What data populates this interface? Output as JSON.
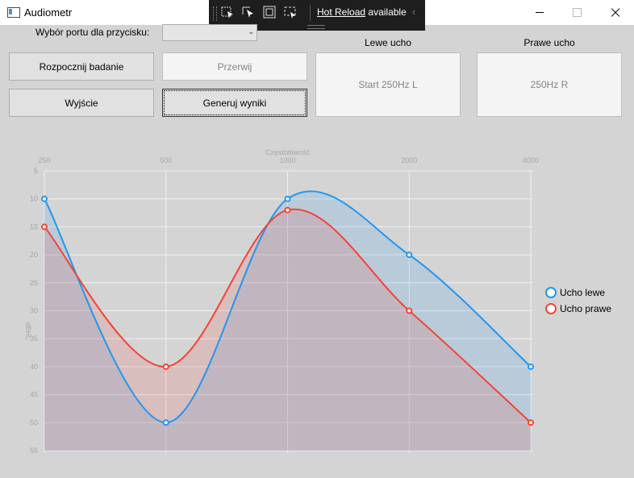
{
  "window": {
    "title": "Audiometr"
  },
  "hot_reload": {
    "link_text": "Hot Reload",
    "suffix": "available"
  },
  "controls": {
    "port_label": "Wybór portu dla przycisku:",
    "port_value": "",
    "start_button": "Rozpocznij badanie",
    "stop_button": "Przerwij",
    "exit_button": "Wyjście",
    "generate_button": "Generuj wyniki"
  },
  "left_ear": {
    "header": "Lewe ucho",
    "status": "Start 250Hz L"
  },
  "right_ear": {
    "header": "Prawe ucho",
    "status": "250Hz R"
  },
  "colors": {
    "left": "#2196f3",
    "right": "#f44336"
  },
  "chart_data": {
    "type": "area",
    "xlabel": "Częstotliwość",
    "ylabel": "dBHL",
    "categories": [
      "250",
      "500",
      "1000",
      "2000",
      "4000"
    ],
    "y_ticks": [
      "5",
      "10",
      "15",
      "20",
      "25",
      "30",
      "35",
      "40",
      "45",
      "50",
      "55"
    ],
    "ylim": [
      5,
      55
    ],
    "y_inverted": true,
    "grid": true,
    "legend_position": "right",
    "series": [
      {
        "name": "Ucho lewe",
        "values": [
          10,
          50,
          10,
          20,
          40
        ]
      },
      {
        "name": "Ucho prawe",
        "values": [
          15,
          40,
          12,
          30,
          50
        ]
      }
    ]
  }
}
